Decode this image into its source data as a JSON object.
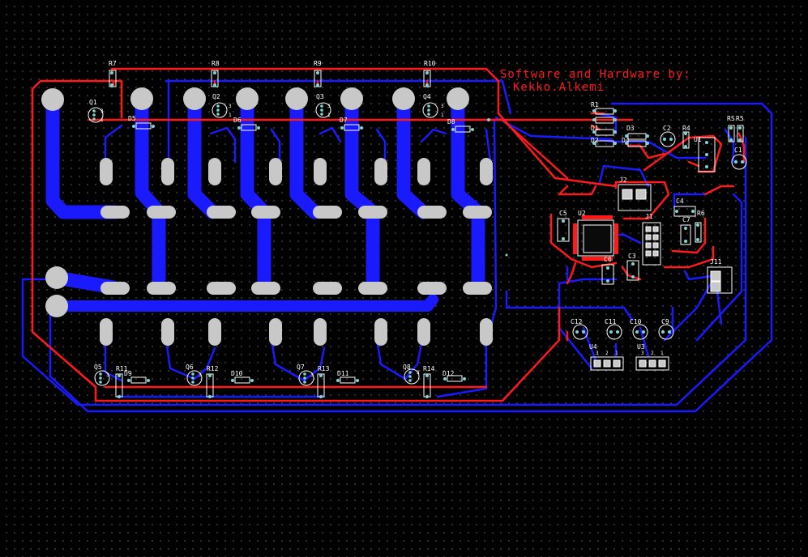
{
  "credit": {
    "line1": "Software and Hardware by:",
    "line2": "Kekko.Alkemi"
  },
  "colors": {
    "background": "#000000",
    "top_copper": "#ff1a1a",
    "bottom_copper": "#1a1aff",
    "pad": "#c8c8c8",
    "overlay": "#ffffff",
    "via": "#7fd4d4"
  },
  "designators": {
    "resistors": [
      "R7",
      "R8",
      "R9",
      "R10",
      "R1",
      "R4",
      "R5",
      "R6",
      "R11",
      "R12",
      "R13",
      "R14"
    ],
    "rs_label": "RS",
    "transistors": [
      "Q1",
      "Q2",
      "Q3",
      "Q4",
      "Q5",
      "Q6",
      "Q7",
      "Q8"
    ],
    "diodes": [
      "D1",
      "D2",
      "D3",
      "D4",
      "D5",
      "D6",
      "D7",
      "D8",
      "D9",
      "D10",
      "D11",
      "D12"
    ],
    "capacitors": [
      "C1",
      "C2",
      "C3",
      "C4",
      "C5",
      "C6",
      "C7",
      "C9",
      "C10",
      "C11",
      "C12"
    ],
    "ics": [
      "U1",
      "U2",
      "U3",
      "U4"
    ],
    "connectors": [
      "J1",
      "J2",
      "J11"
    ],
    "pin_numbers": [
      "1",
      "2",
      "3"
    ]
  }
}
